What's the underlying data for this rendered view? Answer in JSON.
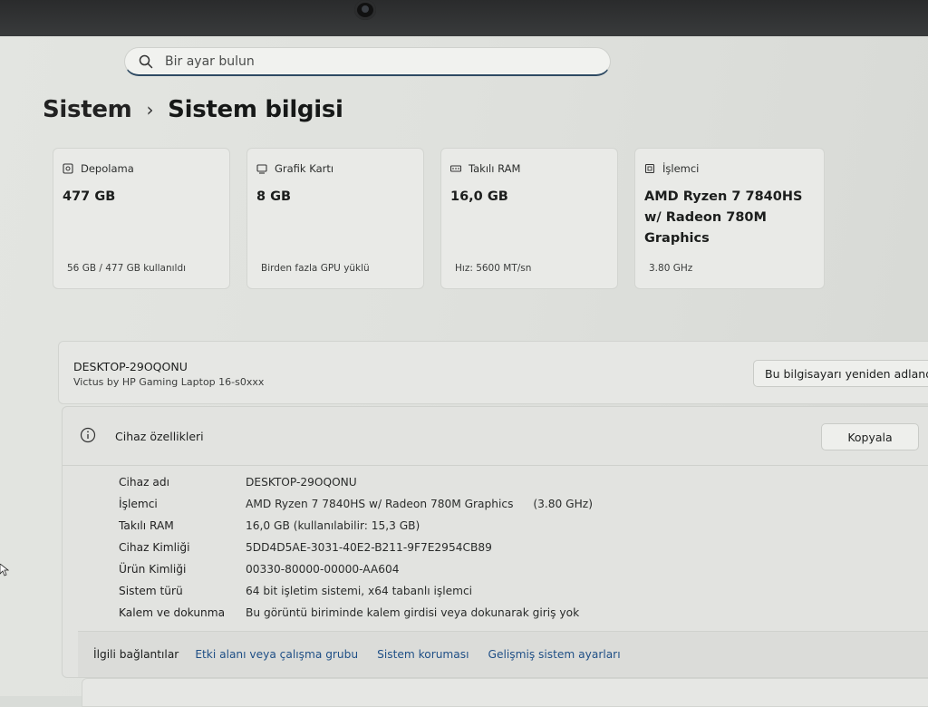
{
  "search": {
    "placeholder": "Bir ayar bulun"
  },
  "breadcrumb": {
    "root": "Sistem",
    "separator": "›",
    "current": "Sistem bilgisi"
  },
  "cards": [
    {
      "icon": "storage-icon",
      "title": "Depolama",
      "value": "477 GB",
      "sub": "56 GB / 477 GB kullanıldı"
    },
    {
      "icon": "gpu-icon",
      "title": "Grafik Kartı",
      "value": "8 GB",
      "sub": "Birden fazla GPU yüklü"
    },
    {
      "icon": "ram-icon",
      "title": "Takılı RAM",
      "value": "16,0 GB",
      "sub": "Hız: 5600 MT/sn"
    },
    {
      "icon": "cpu-icon",
      "title": "İşlemci",
      "value": "AMD Ryzen 7 7840HS w/ Radeon 780M Graphics",
      "sub": "3.80 GHz"
    }
  ],
  "device": {
    "name": "DESKTOP-29OQONU",
    "model": "Victus by HP Gaming Laptop 16-s0xxx",
    "rename_label": "Bu bilgisayarı yeniden adlandır"
  },
  "specs": {
    "title": "Cihaz özellikleri",
    "copy_label": "Kopyala",
    "rows": [
      {
        "label": "Cihaz adı",
        "value": "DESKTOP-29OQONU"
      },
      {
        "label": "İşlemci",
        "value": "AMD Ryzen 7 7840HS w/ Radeon 780M Graphics",
        "extra": "(3.80 GHz)"
      },
      {
        "label": "Takılı RAM",
        "value": "16,0 GB (kullanılabilir: 15,3 GB)"
      },
      {
        "label": "Cihaz Kimliği",
        "value": "5DD4D5AE-3031-40E2-B211-9F7E2954CB89"
      },
      {
        "label": "Ürün Kimliği",
        "value": "00330-80000-00000-AA604"
      },
      {
        "label": "Sistem türü",
        "value": "64 bit işletim sistemi, x64 tabanlı işlemci"
      },
      {
        "label": "Kalem ve dokunma",
        "value": "Bu görüntü biriminde kalem girdisi veya dokunarak giriş yok"
      }
    ]
  },
  "related": {
    "label": "İlgili bağlantılar",
    "links": [
      "Etki alanı veya çalışma grubu",
      "Sistem koruması",
      "Gelişmiş sistem ayarları"
    ]
  },
  "colors": {
    "link": "#1f4f86",
    "search_underline": "#2e4a63"
  }
}
